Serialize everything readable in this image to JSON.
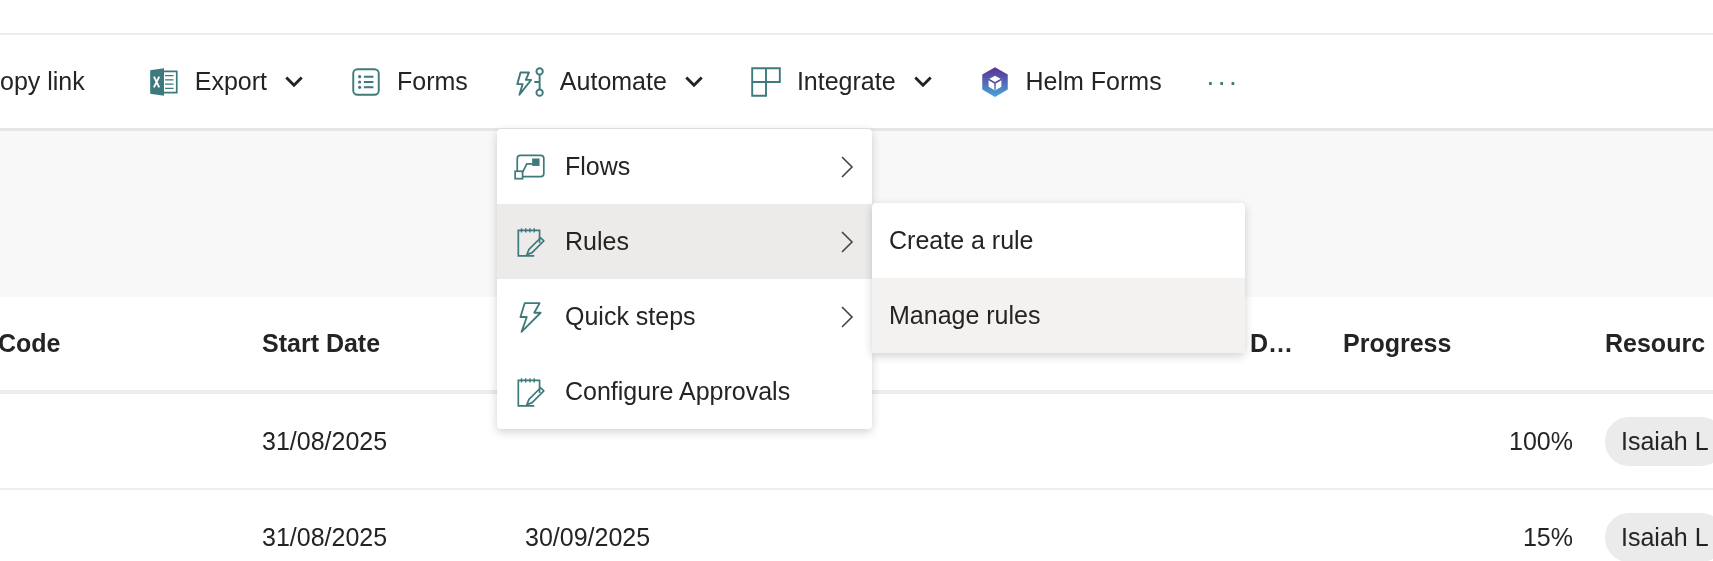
{
  "toolbar": [
    {
      "label": "opy link",
      "kind": "plain",
      "dropdown": false
    },
    {
      "label": "Export",
      "kind": "excel",
      "dropdown": true
    },
    {
      "label": "Forms",
      "kind": "forms",
      "dropdown": false
    },
    {
      "label": "Automate",
      "kind": "automate",
      "dropdown": true
    },
    {
      "label": "Integrate",
      "kind": "integrate",
      "dropdown": true
    },
    {
      "label": "Helm Forms",
      "kind": "helm",
      "dropdown": false
    }
  ],
  "more": "···",
  "menu": [
    {
      "label": "Flows",
      "kind": "flow",
      "submenu": true,
      "selected": false
    },
    {
      "label": "Rules",
      "kind": "note",
      "submenu": true,
      "selected": true
    },
    {
      "label": "Quick steps",
      "kind": "bolt",
      "submenu": true,
      "selected": false
    },
    {
      "label": "Configure Approvals",
      "kind": "note",
      "submenu": false,
      "selected": false
    }
  ],
  "submenu": [
    {
      "label": "Create a rule",
      "selected": false
    },
    {
      "label": "Manage rules",
      "selected": true
    }
  ],
  "table": {
    "columns": [
      "Code",
      "Start Date",
      null,
      "D…",
      "Progress",
      "Resourc"
    ],
    "rows": [
      {
        "cells": [
          null,
          "31/08/2025",
          null,
          null,
          "100%",
          "Isaiah L"
        ]
      },
      {
        "cells": [
          null,
          "31/08/2025",
          "30/09/2025",
          null,
          "15%",
          "Isaiah L"
        ]
      }
    ]
  }
}
